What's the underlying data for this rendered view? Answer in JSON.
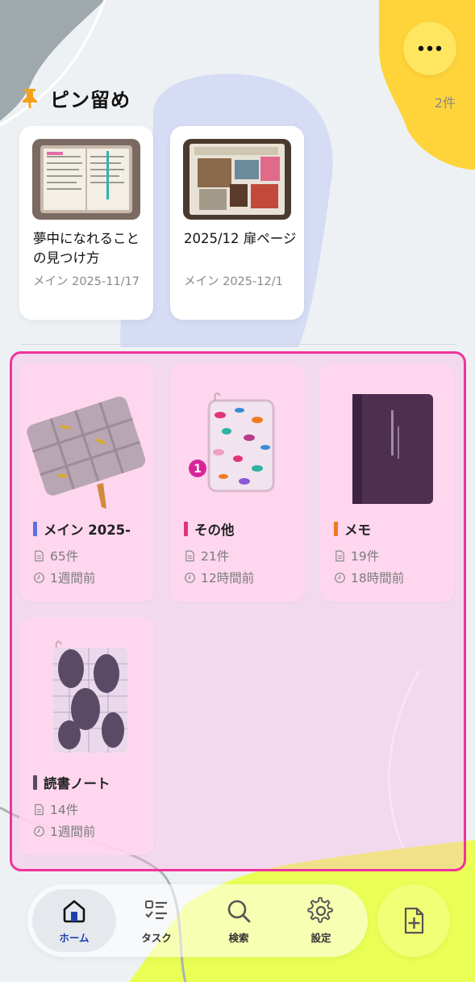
{
  "header": {
    "more_icon": "more-horizontal-icon",
    "accent": "#ffe660"
  },
  "pinned": {
    "title": "ピン留め",
    "count": "2件",
    "icon": "pin-icon",
    "items": [
      {
        "title": "夢中になれることの見つけ方",
        "meta": "メイン 2025-11/17"
      },
      {
        "title": "2025/12 扉ページ",
        "meta": "メイン 2025-12/1"
      }
    ]
  },
  "notebooks": [
    {
      "title": "メイン 2025-",
      "count": "65件",
      "updated": "1週間前",
      "color": "#5f6fe3"
    },
    {
      "title": "その他",
      "count": "21件",
      "updated": "12時間前",
      "color": "#e0337a",
      "badge": "1"
    },
    {
      "title": "メモ",
      "count": "19件",
      "updated": "18時間前",
      "color": "#f07a22"
    },
    {
      "title": "読書ノート",
      "count": "14件",
      "updated": "1週間前",
      "color": "#5a4a66"
    }
  ],
  "nav": {
    "tabs": [
      {
        "label": "ホーム",
        "icon": "home-icon",
        "active": true
      },
      {
        "label": "タスク",
        "icon": "task-list-icon"
      },
      {
        "label": "検索",
        "icon": "search-icon"
      },
      {
        "label": "設定",
        "icon": "gear-icon"
      }
    ],
    "add_icon": "add-document-icon"
  },
  "colors": {
    "highlight_border": "#f0339a",
    "active_tab_text": "#1f3fae"
  }
}
